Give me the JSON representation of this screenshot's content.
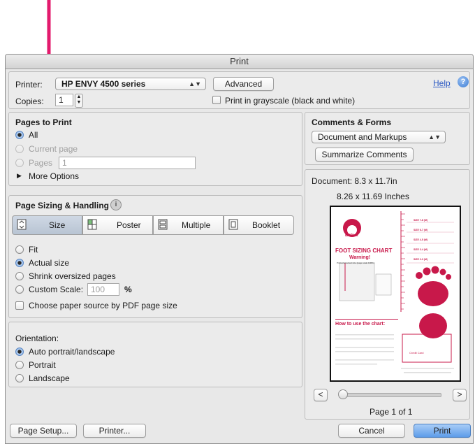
{
  "window": {
    "title": "Print"
  },
  "printer": {
    "label": "Printer:",
    "selected": "HP ENVY 4500 series",
    "advanced_label": "Advanced",
    "help_label": "Help",
    "help_icon": "?",
    "copies_label": "Copies:",
    "copies_value": "1",
    "grayscale_label": "Print in grayscale (black and white)",
    "grayscale_checked": false
  },
  "pages": {
    "header": "Pages to Print",
    "all_label": "All",
    "current_label": "Current page",
    "pages_label": "Pages",
    "pages_value": "1",
    "more_label": "More Options"
  },
  "sizing": {
    "header": "Page Sizing & Handling",
    "info_icon": "i",
    "tabs": [
      {
        "label": "Size"
      },
      {
        "label": "Poster"
      },
      {
        "label": "Multiple"
      },
      {
        "label": "Booklet"
      }
    ],
    "fit_label": "Fit",
    "actual_label": "Actual size",
    "shrink_label": "Shrink oversized pages",
    "custom_label": "Custom Scale:",
    "custom_value": "100",
    "percent": "%",
    "paper_source_label": "Choose paper source by PDF page size"
  },
  "orientation": {
    "header": "Orientation:",
    "auto_label": "Auto portrait/landscape",
    "portrait_label": "Portrait",
    "landscape_label": "Landscape"
  },
  "comments": {
    "header": "Comments & Forms",
    "selected": "Document and Markups",
    "summarize_label": "Summarize Comments"
  },
  "document": {
    "size_label": "Document: 8.3 x 11.7in",
    "inches_label": "8.26 x 11.69 Inches",
    "page_label": "Page 1 of 1",
    "prev_label": "<",
    "next_label": ">"
  },
  "footer": {
    "page_setup_label": "Page Setup...",
    "printer_label": "Printer...",
    "cancel_label": "Cancel",
    "print_label": "Print"
  },
  "preview_doc": {
    "brand": "Bobux",
    "title": "FOOT SIZING CHART",
    "warning": "Warning!",
    "subnote": "Printed at actual size (page scale 100%)",
    "size_rows": [
      "SIZE 7-8 (M)",
      "SIZE 6-7 (M)",
      "SIZE 4-5 (M)",
      "SIZE 3-4 (M)",
      "SIZE 2-3 (M)"
    ],
    "how_title": "How to use the chart:",
    "card_text": "Credit Card"
  },
  "colors": {
    "accent": "#e31b6d",
    "brand_pink": "#c8184a",
    "selection_blue": "#3a7bd5"
  }
}
